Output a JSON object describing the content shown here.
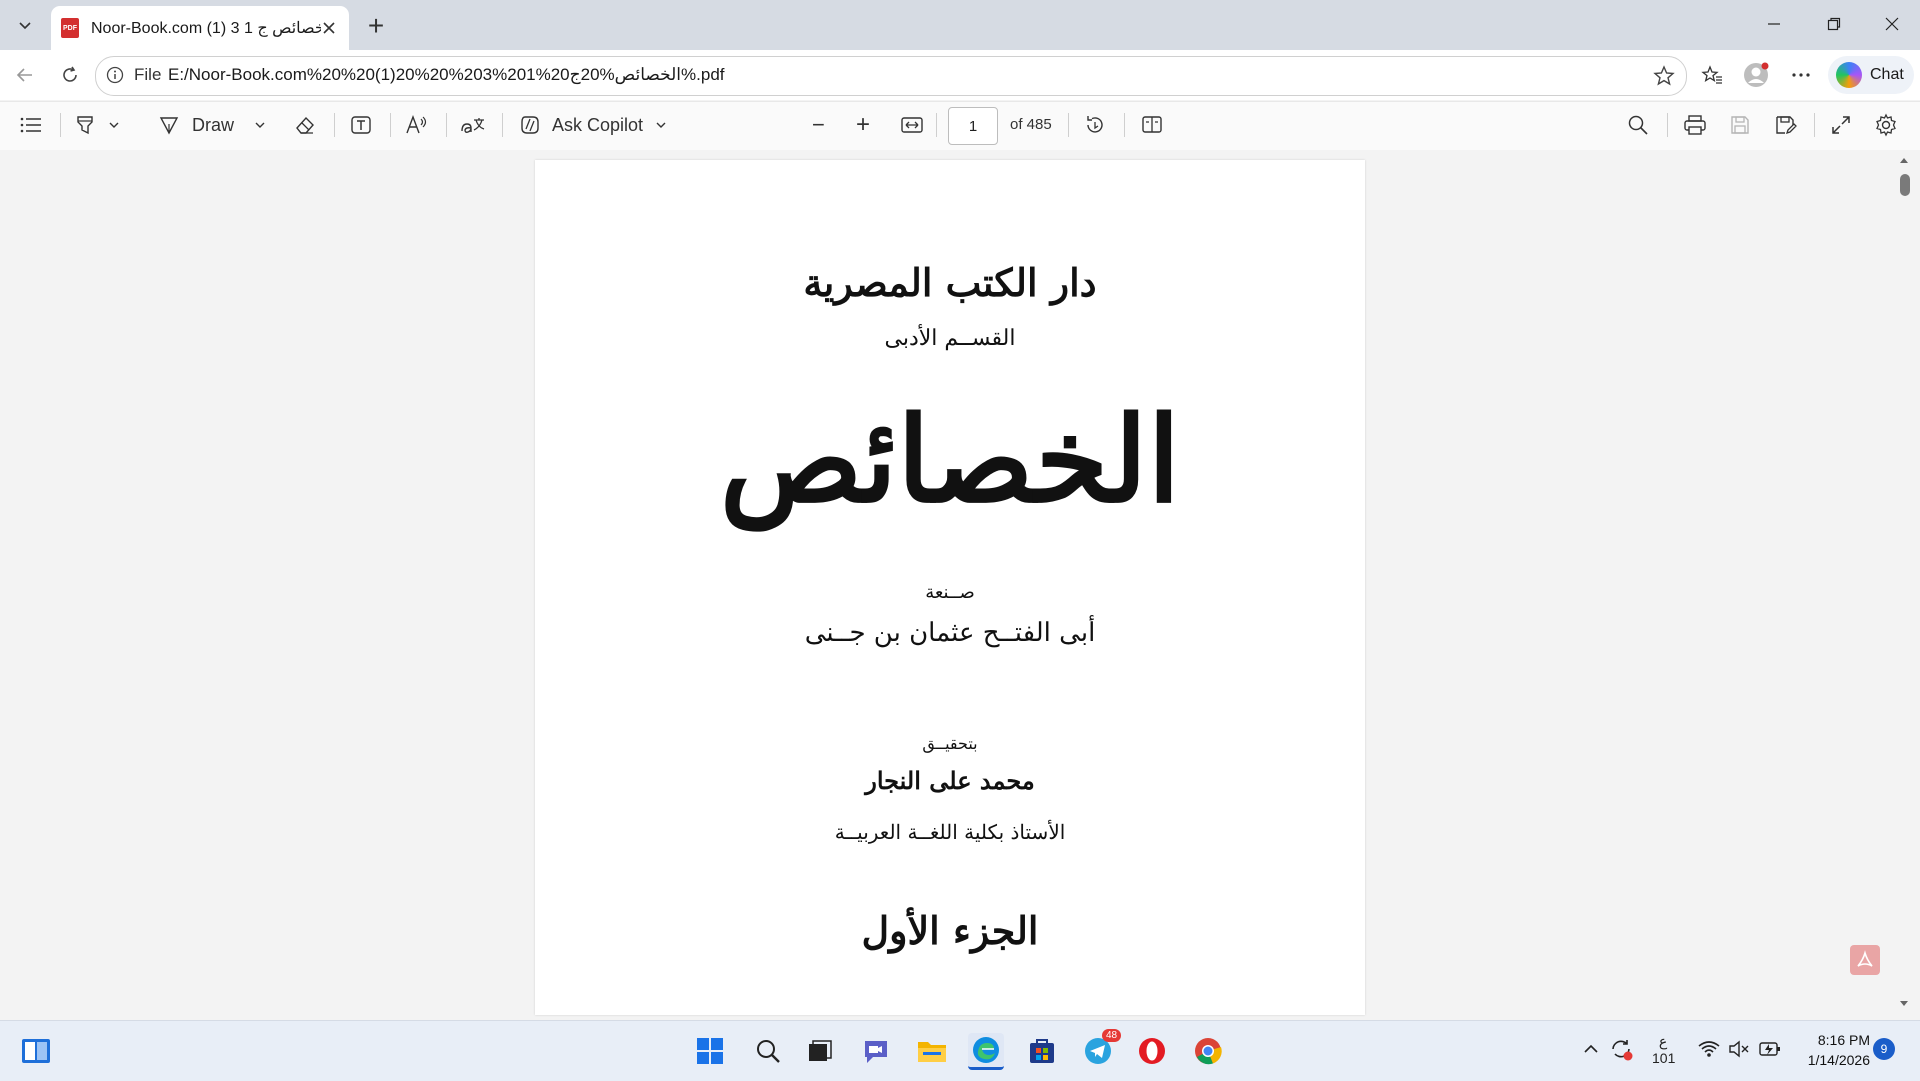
{
  "browser": {
    "tab_title": "Noor-Book.com الخصائص ج 1 3 (1)",
    "pdf_badge": "PDF",
    "new_tab": "+",
    "url_scheme": "File",
    "url": "E:/Noor-Book.com%20%20(1)20%20%203%201%الخصائص%20ج20%.pdf",
    "chat_label": "Chat"
  },
  "pdf_toolbar": {
    "draw_label": "Draw",
    "ask_copilot_label": "Ask Copilot",
    "zoom_out": "−",
    "zoom_in": "+",
    "page_current": "1",
    "page_total_label": "of 485"
  },
  "document": {
    "publisher": "دار الكتب المصرية",
    "section": "القســم الأدبى",
    "title": "الخصائص",
    "made_by_label": "صــنعة",
    "author": "أبى الفتــح عثمان بن جــنى",
    "edited_by_label": "بتحقيــق",
    "editor": "محمد على النجار",
    "editor_title": "الأستاذ بكلية اللغــة العربيــة",
    "volume": "الجزء الأول"
  },
  "taskbar": {
    "telegram_badge": "48",
    "tray_lang": "ع",
    "tray_num": "101",
    "time": "8:16 PM",
    "date": "1/14/2026",
    "notification_count": "9"
  },
  "colors": {
    "accent": "#1a5dc9",
    "pdf_red": "#d32f2f",
    "tabstrip": "#d6dbe3"
  }
}
